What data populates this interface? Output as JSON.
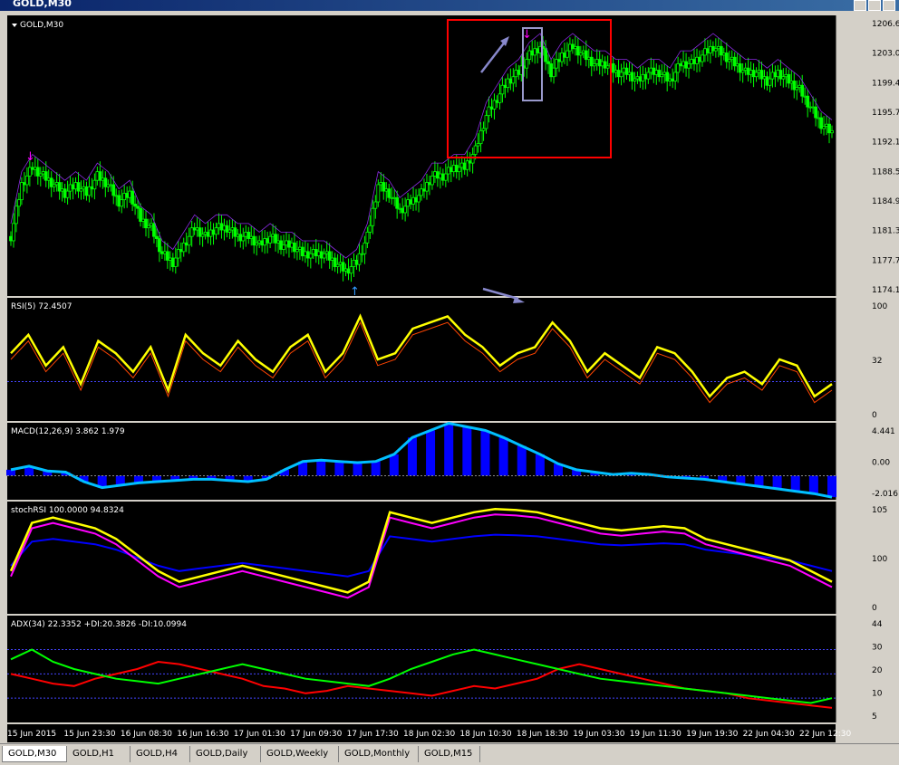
{
  "window": {
    "title": "GOLD,M30"
  },
  "tabs": [
    "GOLD,M30",
    "GOLD,H1",
    "GOLD,H4",
    "GOLD,Daily",
    "GOLD,Weekly",
    "GOLD,Monthly",
    "GOLD,M15"
  ],
  "active_tab": 0,
  "colors": {
    "background": "#000000",
    "candle": "#00ff00",
    "rsi": "#ffff00",
    "macd_hist": "#0000ff",
    "macd_line": "#00bfff",
    "adx_plus": "#ff0000",
    "adx_minus": "#00ff00",
    "stoch_k": "#ffff00",
    "stoch_d": "#ff00ff"
  },
  "chart_data": [
    {
      "type": "candlestick",
      "title": "GOLD,M30",
      "y_ticks": [
        "1206.60",
        "1203.00",
        "1199.40",
        "1195.70",
        "1192.10",
        "1188.50",
        "1184.90",
        "1181.30",
        "1177.70",
        "1174.10"
      ],
      "ylim": [
        1174.1,
        1206.6
      ],
      "x_ticks": [
        "15 Jun 2015",
        "15 Jun 23:30",
        "16 Jun 08:30",
        "16 Jun 16:30",
        "17 Jun 01:30",
        "17 Jun 09:30",
        "17 Jun 17:30",
        "18 Jun 02:30",
        "18 Jun 10:30",
        "18 Jun 18:30",
        "19 Jun 03:30",
        "19 Jun 11:30",
        "19 Jun 19:30",
        "22 Jun 04:30",
        "22 Jun 12:30"
      ],
      "close_path": [
        1181,
        1187,
        1189,
        1188,
        1187,
        1186,
        1187,
        1186,
        1188,
        1187,
        1185,
        1186,
        1183,
        1182,
        1179,
        1178,
        1180,
        1182,
        1181,
        1182,
        1182,
        1181,
        1181,
        1180,
        1181,
        1180,
        1180,
        1179,
        1179,
        1179,
        1178,
        1177,
        1178,
        1181,
        1187,
        1186,
        1184,
        1185,
        1186,
        1188,
        1188,
        1189,
        1189,
        1191,
        1195,
        1197,
        1199,
        1200,
        1202,
        1203,
        1200,
        1202,
        1203,
        1202,
        1201,
        1201,
        1200,
        1200,
        1199,
        1200,
        1200,
        1199,
        1201,
        1201,
        1202,
        1203,
        1202,
        1201,
        1200,
        1200,
        1199,
        1200,
        1199,
        1198,
        1196,
        1194,
        1193
      ]
    },
    {
      "type": "line",
      "title": "RSI(5) 72.4507",
      "y_ticks": [
        "100",
        "32",
        "0"
      ],
      "ylim": [
        0,
        100
      ],
      "series": [
        {
          "values": [
            55,
            70,
            45,
            60,
            30,
            65,
            55,
            40,
            60,
            25,
            70,
            55,
            45,
            65,
            50,
            40,
            60,
            70,
            40,
            55,
            85,
            50,
            55,
            75,
            80,
            85,
            70,
            60,
            45,
            55,
            60,
            80,
            65,
            40,
            55,
            45,
            35,
            60,
            55,
            40,
            20,
            35,
            40,
            30,
            50,
            45,
            20,
            30
          ]
        }
      ]
    },
    {
      "type": "bar",
      "title": "MACD(12,26,9) 3.862 1.979",
      "y_ticks": [
        "4.441",
        "0.00",
        "-2.016"
      ],
      "ylim": [
        -2.016,
        4.441
      ],
      "values": [
        0.5,
        0.8,
        0.4,
        0.3,
        -0.5,
        -1.0,
        -0.8,
        -0.6,
        -0.5,
        -0.4,
        -0.3,
        -0.3,
        -0.4,
        -0.5,
        -0.3,
        0.5,
        1.2,
        1.3,
        1.2,
        1.1,
        1.2,
        1.8,
        3.2,
        3.8,
        4.4,
        4.1,
        3.8,
        3.2,
        2.5,
        1.8,
        1.0,
        0.5,
        0.3,
        0.1,
        0.2,
        0.1,
        -0.1,
        -0.2,
        -0.3,
        -0.5,
        -0.7,
        -0.9,
        -1.1,
        -1.3,
        -1.5,
        -1.8
      ]
    },
    {
      "type": "line",
      "title": "stochRSI 100.0000 94.8324",
      "y_ticks": [
        "105",
        "100",
        "0"
      ],
      "ylim": [
        0,
        105
      ],
      "series": [
        {
          "values": [
            40,
            85,
            90,
            85,
            80,
            70,
            55,
            40,
            30,
            35,
            40,
            45,
            40,
            35,
            30,
            25,
            20,
            30,
            95,
            90,
            85,
            90,
            95,
            98,
            97,
            95,
            90,
            85,
            80,
            78,
            80,
            82,
            80,
            70,
            65,
            60,
            55,
            50,
            40,
            30
          ]
        }
      ]
    },
    {
      "type": "line",
      "title": "ADX(34) 22.3352 +DI:20.3826 -DI:10.0994",
      "y_ticks": [
        "44",
        "30",
        "20",
        "10",
        "5"
      ],
      "ylim": [
        0,
        44
      ],
      "series": [
        {
          "values": [
            20,
            18,
            16,
            15,
            18,
            20,
            22,
            25,
            24,
            22,
            20,
            18,
            15,
            14,
            12,
            13,
            15,
            14,
            13,
            12,
            11,
            13,
            15,
            14,
            16,
            18,
            22,
            24,
            22,
            20,
            18,
            16,
            14,
            13,
            12,
            10,
            9,
            8,
            7,
            6
          ]
        },
        {
          "values": [
            26,
            30,
            25,
            22,
            20,
            18,
            17,
            16,
            18,
            20,
            22,
            24,
            22,
            20,
            18,
            17,
            16,
            15,
            18,
            22,
            25,
            28,
            30,
            28,
            26,
            24,
            22,
            20,
            18,
            17,
            16,
            15,
            14,
            13,
            12,
            11,
            10,
            9,
            8,
            10
          ]
        }
      ]
    }
  ]
}
